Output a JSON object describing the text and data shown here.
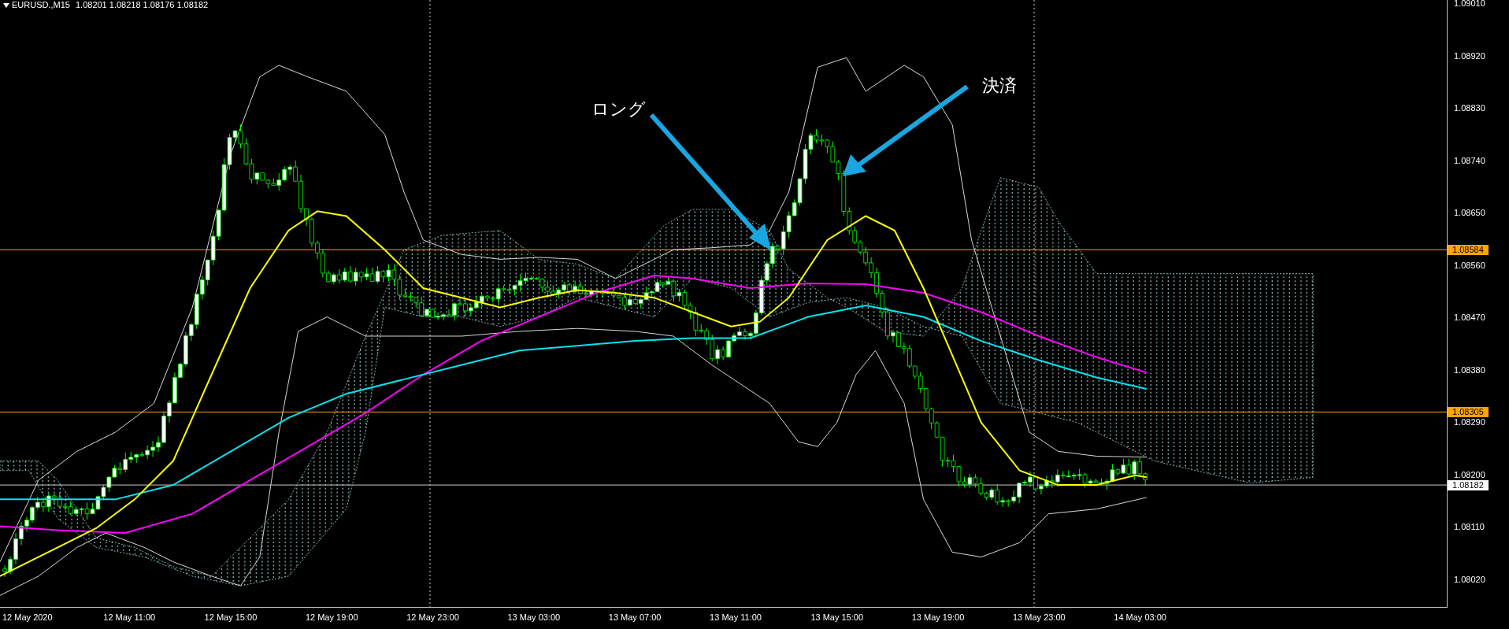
{
  "header": {
    "symbol": "EURUSD.,M15",
    "prices": "1.08201 1.08218 1.08176 1.08182"
  },
  "annotations": [
    {
      "text": "ロング"
    },
    {
      "text": "決済"
    }
  ],
  "price_axis": [
    "1.09010",
    "1.08920",
    "1.08830",
    "1.08740",
    "1.08650",
    "1.08560",
    "1.08470",
    "1.08380",
    "1.08290",
    "1.08200",
    "1.08110",
    "1.08020"
  ],
  "price_tags": [
    {
      "text": "1.08584",
      "color": "#ffa500"
    },
    {
      "text": "1.08305",
      "color": "#ffa500"
    },
    {
      "text": "1.08182",
      "color": "#ffffff"
    }
  ],
  "time_axis": [
    "12 May 2020",
    "12 May 11:00",
    "12 May 15:00",
    "12 May 19:00",
    "12 May 23:00",
    "13 May 03:00",
    "13 May 07:00",
    "13 May 11:00",
    "13 May 15:00",
    "13 May 19:00",
    "13 May 23:00",
    "14 May 03:00"
  ]
}
